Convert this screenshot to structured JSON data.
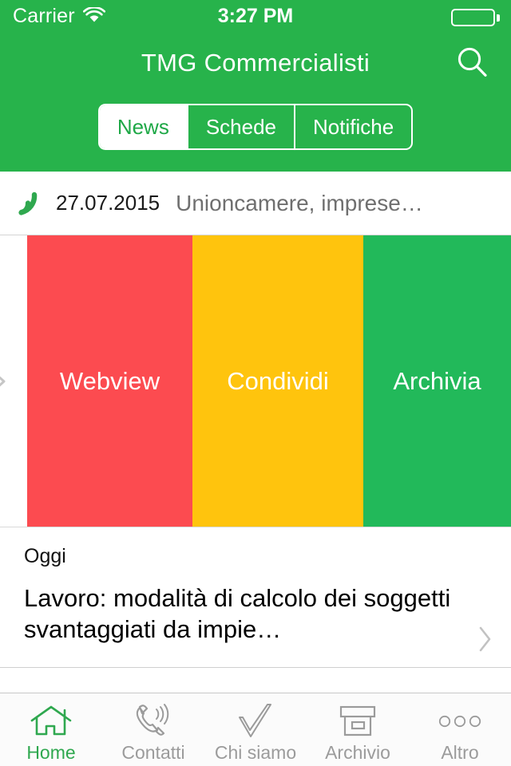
{
  "status_bar": {
    "carrier": "Carrier",
    "wifi_icon": "wifi-icon",
    "time": "3:27 PM",
    "battery_icon": "battery-empty-icon"
  },
  "header": {
    "title": "TMG Commercialisti",
    "search_icon": "search-icon",
    "background_color": "#27b34b",
    "segmented_control": {
      "selected": "News",
      "options": [
        {
          "label": "News",
          "active": true
        },
        {
          "label": "Schede",
          "active": false
        },
        {
          "label": "Notifiche",
          "active": false
        }
      ]
    }
  },
  "list": {
    "news_row": {
      "icon": "rss-icon",
      "icon_color": "#2fa84f",
      "date": "27.07.2015",
      "title": "Unioncamere, imprese…"
    },
    "swipe_actions": {
      "chevron_icon": "chevron-right-icon",
      "buttons": [
        {
          "label": "Webview",
          "color": "#fc4b50"
        },
        {
          "label": "Condividi",
          "color": "#ffc40d"
        },
        {
          "label": "Archivia",
          "color": "#22b95a"
        }
      ]
    },
    "article_row": {
      "kicker": "Oggi",
      "title": "Lavoro: modalità di calcolo dei soggetti svantaggiati da impie…",
      "chevron_icon": "chevron-right-icon"
    }
  },
  "tabbar": {
    "items": [
      {
        "label": "Home",
        "icon": "home-icon",
        "active": true
      },
      {
        "label": "Contatti",
        "icon": "phone-icon",
        "active": false
      },
      {
        "label": "Chi siamo",
        "icon": "checkmark-icon",
        "active": false
      },
      {
        "label": "Archivio",
        "icon": "archive-box-icon",
        "active": false
      },
      {
        "label": "Altro",
        "icon": "more-dots-icon",
        "active": false
      }
    ],
    "active_color": "#2fa84f",
    "inactive_color": "#9b9b9b"
  }
}
